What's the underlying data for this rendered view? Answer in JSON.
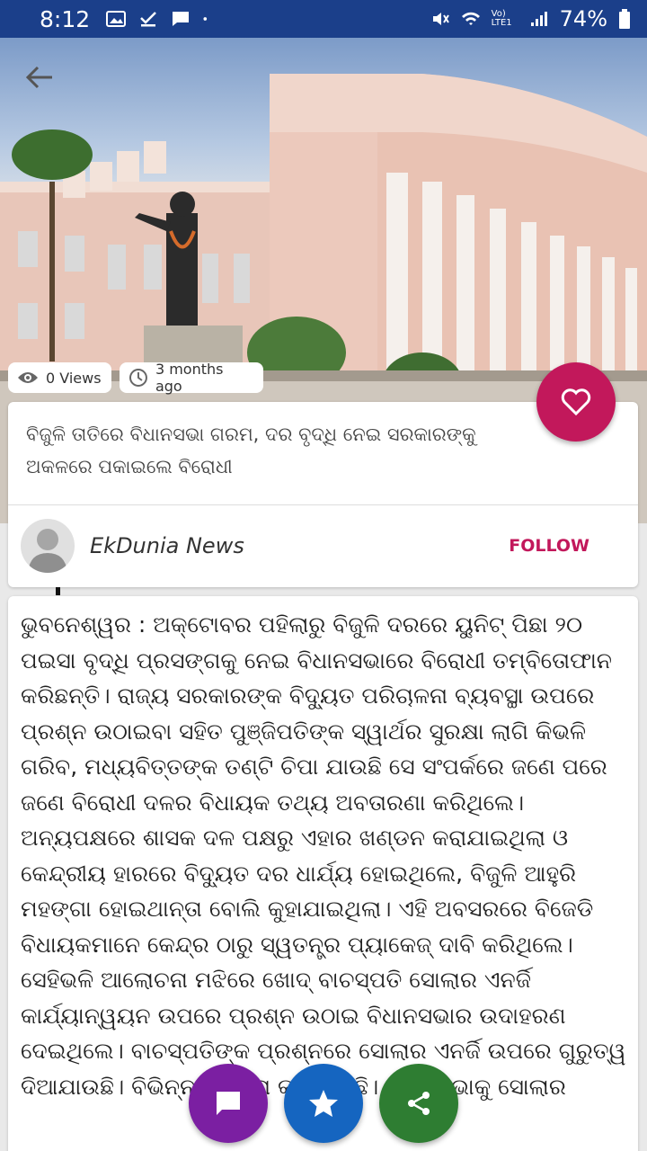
{
  "status_bar": {
    "time": "8:12",
    "battery": "74%",
    "network": "Vo) LTE1"
  },
  "hero": {
    "views": "0 Views",
    "age": "3 months ago"
  },
  "article": {
    "title": "ବିଜୁଳି ତାତିରେ ବିଧାନସଭା ଗରମ, ଦର ବୃଦ୍ଧି ନେଇ ସରକାରଙ୍କୁ ଅକଳରେ ପକାଇଲେ ବିରୋଧୀ",
    "author": "EkDunia News",
    "follow_label": "FOLLOW",
    "body": "ଭୁବନେଶ୍ୱର : ଅକ୍ଟୋବର ପହିଲାରୁ ବିଜୁଳି ଦରରେ ୟୁନିଟ୍ ପିଛା ୨୦ ପଇସା ବୃଦ୍ଧି ପ୍ରସଙ୍ଗକୁ ନେଇ ବିଧାନସଭାରେ ବିରୋଧୀ ତମ୍ବିତୋଫାନ କରିଛନ୍ତି। ରାଜ୍ୟ ସରକାରଙ୍କ ବିଦ୍ୟୁତ ପରିଚାଳନା ବ୍ୟବସ୍ଥା ଉପରେ ପ୍ରଶ୍ନ ଉଠାଇବା ସହିତ ପୁଞ୍ଜିପତିଙ୍କ ସ୍ୱାର୍ଥର ସୁରକ୍ଷା ଲାଗି କିଭଳି ଗରିବ, ମଧ୍ୟବିତ୍ତଙ୍କ ତଣ୍ଟି ଚିପା ଯାଉଛି ସେ ସଂପର୍କରେ ଜଣେ ପରେ ଜଣେ ବିରୋଧୀ ଦଳର ବିଧାୟକ ତଥ୍ୟ ଅବତାରଣା କରିଥିଲେ। ଅନ୍ୟପକ୍ଷରେ ଶାସକ ଦଳ ପକ୍ଷରୁ ଏହାର ଖଣ୍ଡନ କରାଯାଇଥିଲା ଓ କେନ୍ଦ୍ରୀୟ ହାରରେ ବିଦ୍ୟୁତ ଦର ଧାର୍ଯ୍ୟ ହୋଇଥିଲେ, ବିଜୁଳି ଆହୁରି ମହଙ୍ଗା ହୋଇଥାନ୍ତା ବୋଲି କୁହାଯାଇଥିଲା। ଏହି ଅବସରରେ ବିଜେଡି ବିଧାୟକମାନେ କେନ୍ଦ୍ର ଠାରୁ ସ୍ୱତନ୍ତ୍ର ପ୍ୟାକେଜ୍ ଦାବି କରିଥିଲେ। ସେହିଭଳି ଆଲୋଚନା ମଝିରେ ଖୋଦ୍ ବାଚସ୍ପତି ସୋଲାର ଏନର୍ଜି କାର୍ଯ୍ୟାନ୍ୱୟନ ଉପରେ ପ୍ରଶ୍ନ ଉଠାଇ ବିଧାନସଭାର ଉଦାହରଣ ଦେଇଥିଲେ। ବାଚସ୍ପତିଙ୍କ ପ୍ରଶ୍ନରେ ସୋଲାର ଏନର୍ଜି ଉପରେ ଗୁରୁତ୍ୱ ଦିଆଯାଉଛି। ବିଭିନ୍ନ ଯୋଜନା କରାଯାଇଛି। ବିଧାନସଭାକୁ ସୋଲାର"
  },
  "colors": {
    "status_bar": "#1b3f8a",
    "accent": "#c2185b",
    "comment_fab": "#7b1fa2",
    "star_fab": "#1565c0",
    "share_fab": "#2e7d32"
  },
  "icons": [
    "back-arrow-icon",
    "eye-icon",
    "clock-icon",
    "heart-icon",
    "comment-icon",
    "star-icon",
    "share-icon"
  ]
}
